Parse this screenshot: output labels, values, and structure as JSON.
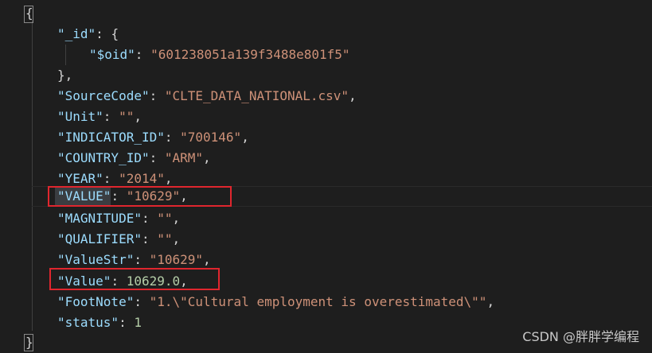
{
  "json_doc": {
    "open_brace": "{",
    "close_brace": "}",
    "id_key": "\"_id\"",
    "id_open": "{",
    "oid_key": "\"$oid\"",
    "oid_value": "\"601238051a139f3488e801f5\"",
    "id_close": "},",
    "source_code_key": "\"SourceCode\"",
    "source_code_value": "\"CLTE_DATA_NATIONAL.csv\"",
    "unit_key": "\"Unit\"",
    "unit_value": "\"\"",
    "indicator_key": "\"INDICATOR_ID\"",
    "indicator_value": "\"700146\"",
    "country_key": "\"COUNTRY_ID\"",
    "country_value": "\"ARM\"",
    "year_key": "\"YEAR\"",
    "year_value": "\"2014\"",
    "value_upper_key": "\"VALUE\"",
    "value_upper_value": "\"10629\"",
    "magnitude_key": "\"MAGNITUDE\"",
    "magnitude_value": "\"\"",
    "qualifier_key": "\"QUALIFIER\"",
    "qualifier_value": "\"\"",
    "valuestr_key": "\"ValueStr\"",
    "valuestr_value": "\"10629\"",
    "value_key": "\"Value\"",
    "value_value": "10629.0",
    "footnote_key": "\"FootNote\"",
    "footnote_value": "\"1.\\\"Cultural employment is overestimated\\\"\"",
    "status_key": "\"status\"",
    "status_value": "1"
  },
  "watermark": "CSDN @胖胖学编程",
  "colors": {
    "background": "#1e1e1e",
    "key": "#9cdcfe",
    "string": "#ce9178",
    "number": "#b5cea8",
    "highlight_box": "#e0262e"
  }
}
